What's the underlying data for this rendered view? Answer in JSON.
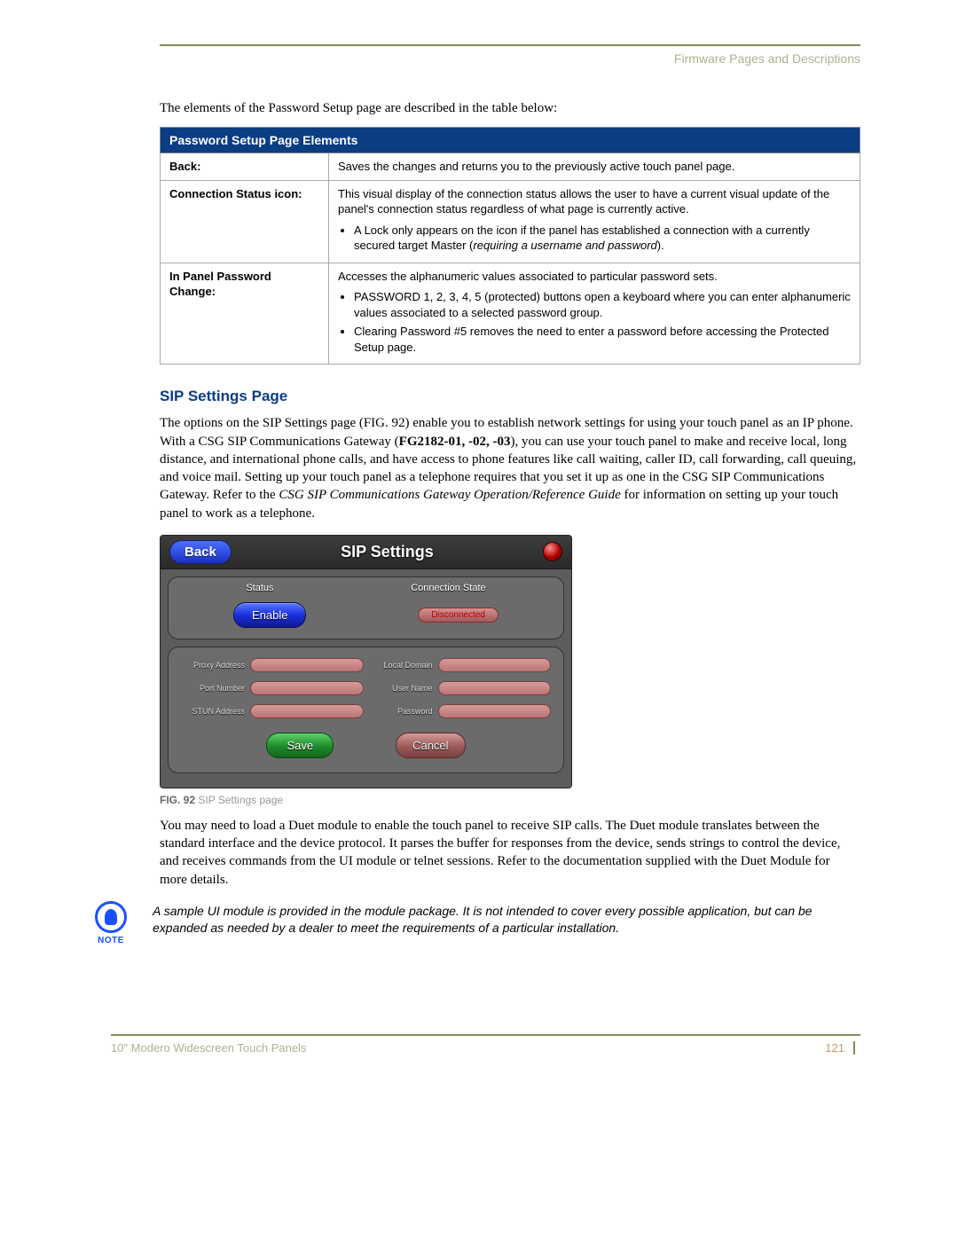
{
  "header": {
    "section": "Firmware Pages and Descriptions"
  },
  "intro": "The elements of the Password Setup page are described in the table below:",
  "table": {
    "title": "Password Setup Page Elements",
    "rows": [
      {
        "label": "Back:",
        "desc": "Saves the changes and returns you to the previously active touch panel page."
      },
      {
        "label": "Connection Status icon:",
        "desc": "This visual display of the connection status allows the user to have a current visual update of the panel's connection status regardless of what page is currently active.",
        "bullets": [
          "A Lock only appears on the icon if the panel has established a connection with a currently secured target Master (<i>requiring a username and password</i>)."
        ]
      },
      {
        "label": "In Panel Password Change:",
        "desc": "Accesses the alphanumeric values associated to particular password sets.",
        "bullets": [
          "PASSWORD 1, 2, 3, 4, 5 (protected) buttons open a keyboard where you can enter alphanumeric values associated to a selected password group.",
          "Clearing Password #5 removes the need to enter a password before accessing the Protected Setup page."
        ]
      }
    ]
  },
  "section_heading": "SIP Settings Page",
  "sip_para_html": "The options on the SIP Settings page (FIG. 92) enable you to establish network settings for using your touch panel as an IP phone. With a CSG SIP Communications Gateway (<b>FG2182-01, -02, -03</b>), you can use your touch panel to make and receive local, long distance, and international phone calls, and have access to phone features like call waiting, caller ID, call forwarding, call queuing, and voice mail. Setting up your touch panel as a telephone requires that you set it up as one in the CSG SIP Communications Gateway. Refer to the <i>CSG SIP Communications Gateway Operation/Reference Guide</i> for information on setting up your touch panel to work as a telephone.",
  "sip_panel": {
    "back": "Back",
    "title": "SIP Settings",
    "status_hdr": "Status",
    "conn_hdr": "Connection State",
    "enable": "Enable",
    "disconnected": "Disconnected",
    "labels": {
      "proxy": "Proxy Address",
      "port": "Port Number",
      "stun": "STUN Address",
      "domain": "Local Domain",
      "user": "User Name",
      "pass": "Password"
    },
    "save": "Save",
    "cancel": "Cancel"
  },
  "fig_caption": {
    "num": "FIG. 92",
    "text": "SIP Settings page"
  },
  "duet_para": "You may need to load a Duet module to enable the touch panel to receive SIP calls. The Duet module translates between the standard interface and the device protocol. It parses the buffer for responses from the device, sends strings to control the device, and receives commands from the UI module or telnet sessions. Refer to the documentation supplied with the Duet Module for more details.",
  "note": {
    "label": "NOTE",
    "text": "A sample UI module is provided in the module package. It is not intended to cover every possible application, but can be expanded as needed by a dealer to meet the requirements of a particular installation."
  },
  "footer": {
    "product": "10\" Modero Widescreen Touch Panels",
    "page": "121"
  }
}
